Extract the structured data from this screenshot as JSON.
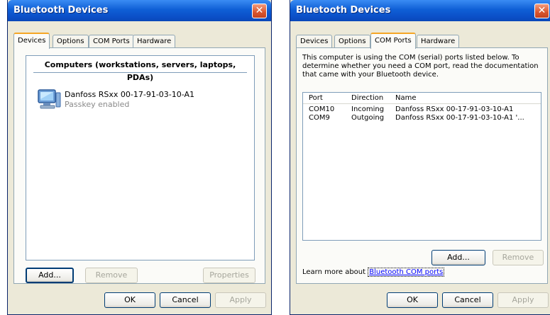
{
  "left_window": {
    "title": "Bluetooth Devices",
    "tabs": [
      "Devices",
      "Options",
      "COM Ports",
      "Hardware"
    ],
    "active_tab": "Devices",
    "group_header": "Computers (workstations, servers, laptops, PDAs)",
    "device": {
      "name": "Danfoss RSxx 00-17-91-03-10-A1",
      "status": "Passkey enabled",
      "icon": "computer-icon"
    },
    "buttons": {
      "add": "Add...",
      "remove": "Remove",
      "properties": "Properties"
    },
    "footer": {
      "ok": "OK",
      "cancel": "Cancel",
      "apply": "Apply"
    }
  },
  "right_window": {
    "title": "Bluetooth Devices",
    "tabs": [
      "Devices",
      "Options",
      "COM Ports",
      "Hardware"
    ],
    "active_tab": "COM Ports",
    "description": "This computer is using the COM (serial) ports listed below. To determine whether you need a COM port, read the documentation that came with your Bluetooth device.",
    "columns": [
      "Port",
      "Direction",
      "Name"
    ],
    "rows": [
      {
        "port": "COM10",
        "direction": "Incoming",
        "name": "Danfoss RSxx 00-17-91-03-10-A1"
      },
      {
        "port": "COM9",
        "direction": "Outgoing",
        "name": "Danfoss RSxx 00-17-91-03-10-A1 '..."
      }
    ],
    "buttons": {
      "add": "Add...",
      "remove": "Remove"
    },
    "learn_more_prefix": "Learn more about ",
    "learn_more_link": "Bluetooth COM ports",
    "footer": {
      "ok": "OK",
      "cancel": "Cancel",
      "apply": "Apply"
    }
  },
  "colors": {
    "title_bar": "#0f5fd6",
    "close_button": "#d9552e",
    "active_tab_highlight": "#f5a625"
  }
}
